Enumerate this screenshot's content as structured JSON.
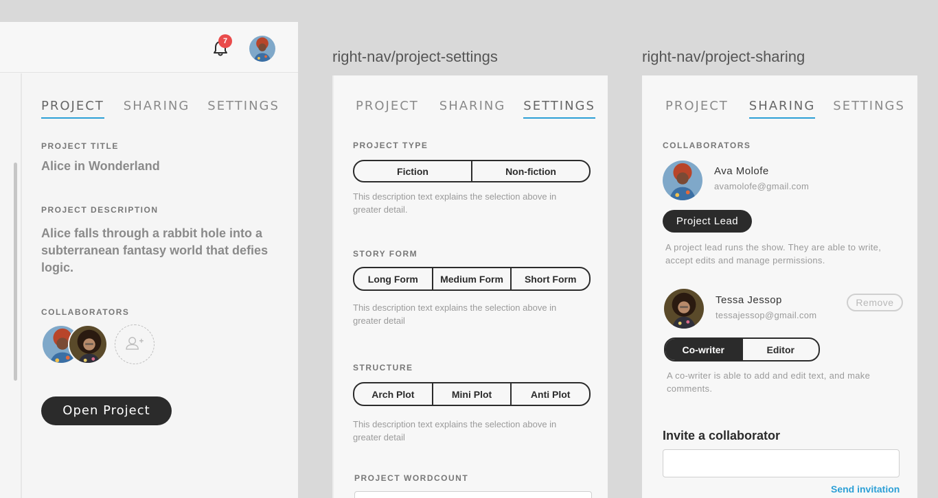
{
  "notifications": {
    "count": "7"
  },
  "panel1": {
    "tabs": [
      "PROJECT",
      "SHARING",
      "SETTINGS"
    ],
    "title_label": "PROJECT TITLE",
    "title_value": "Alice in Wonderland",
    "desc_label": "PROJECT DESCRIPTION",
    "desc_value": "Alice falls through a rabbit hole into a subterranean fantasy world that defies logic.",
    "collab_label": "COLLABORATORS",
    "open_button": "Open Project"
  },
  "panel2": {
    "frame_label": "right-nav/project-settings",
    "tabs": [
      "PROJECT",
      "SHARING",
      "SETTINGS"
    ],
    "type_label": "PROJECT TYPE",
    "type_options": [
      "Fiction",
      "Non-fiction"
    ],
    "type_hint": "This description text explains the selection above in greater detail.",
    "form_label": "STORY FORM",
    "form_options": [
      "Long Form",
      "Medium Form",
      "Short Form"
    ],
    "form_hint": "This description text explains the selection above in greater detail",
    "structure_label": "STRUCTURE",
    "structure_options": [
      "Arch Plot",
      "Mini Plot",
      "Anti Plot"
    ],
    "structure_hint": "This description text explains the selection above in greater detail",
    "wordcount_label": "PROJECT WORDCOUNT"
  },
  "panel3": {
    "frame_label": "right-nav/project-sharing",
    "tabs": [
      "PROJECT",
      "SHARING",
      "SETTINGS"
    ],
    "collab_label": "COLLABORATORS",
    "user1": {
      "name": "Ava Molofe",
      "email": "avamolofe@gmail.com",
      "role": "Project Lead",
      "role_hint": "A project lead runs the show. They are able to write, accept edits and manage permissions."
    },
    "user2": {
      "name": "Tessa Jessop",
      "email": "tessajessop@gmail.com",
      "remove": "Remove",
      "roles": [
        "Co-writer",
        "Editor"
      ],
      "role_hint": "A co-writer is able to add and edit text, and make comments."
    },
    "invite_title": "Invite a collaborator",
    "send_link": "Send invitation"
  },
  "colors": {
    "accent": "#2b9fd6",
    "dark": "#2b2b2b",
    "badge": "#e94b4b"
  },
  "icons": [
    "bell-icon",
    "add-person-icon"
  ]
}
